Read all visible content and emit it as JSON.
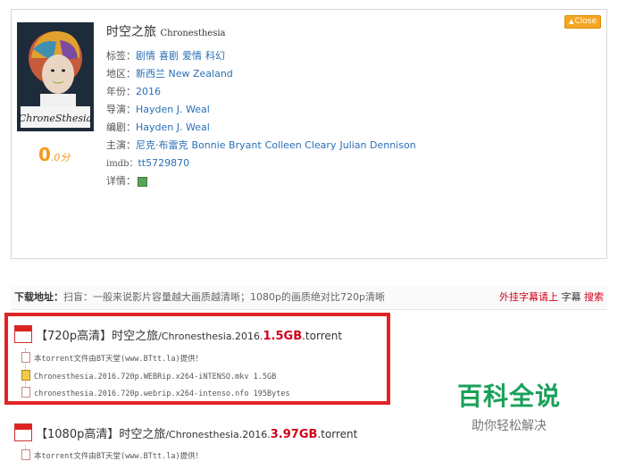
{
  "movie": {
    "close_label": "Close",
    "title_cn": "时空之旅",
    "title_en": "Chronesthesia",
    "poster_text": "ChroneSthesia",
    "score_value": "0",
    "score_unit": ".0分",
    "tags_label": "标签：",
    "tags": [
      "剧情",
      "喜剧",
      "爱情",
      "科幻"
    ],
    "region_label": "地区：",
    "region": "新西兰 New Zealand",
    "year_label": "年份：",
    "year": "2016",
    "director_label": "导演：",
    "director": "Hayden J. Weal",
    "writer_label": "编剧：",
    "writer": "Hayden J. Weal",
    "cast_label": "主演：",
    "cast": [
      "尼克·布雷克",
      "Bonnie Bryant",
      "Colleen Cleary",
      "Julian Dennison"
    ],
    "imdb_label": "imdb：",
    "imdb": "tt5729870",
    "detail_label": "详情："
  },
  "download": {
    "title": "下载地址：",
    "desc": "扫盲：一般来说影片容量越大画质越清晰；1080p的画质绝对比720p清晰",
    "subs_link": "外挂字幕请上",
    "subs_word": "字幕",
    "search_link": "搜索"
  },
  "torrents": [
    {
      "prefix": "【720p高清】时空之旅",
      "name": "/Chronesthesia.2016.",
      "size": "1.5GB",
      "ext": ".torrent",
      "files": [
        "本torrent文件由BT天堂(www.BTtt.la)提供！",
        "Chronesthesia.2016.720p.WEBRip.x264-iNTENSO.mkv 1.5GB",
        "chronesthesia.2016.720p.webrip.x264-intenso.nfo 195Bytes"
      ]
    },
    {
      "prefix": "【1080p高清】时空之旅",
      "name": "/Chronesthesia.2016.",
      "size": "3.97GB",
      "ext": ".torrent",
      "files": [
        "本torrent文件由BT天堂(www.BTtt.la)提供！"
      ]
    }
  ],
  "watermark": {
    "main": "百科全说",
    "sub": "助你轻松解决"
  },
  "colors": {
    "accent_red": "#d0021b",
    "link_blue": "#2a6fb5",
    "score_orange": "#f39a1b",
    "watermark_green": "#1aa05a"
  }
}
